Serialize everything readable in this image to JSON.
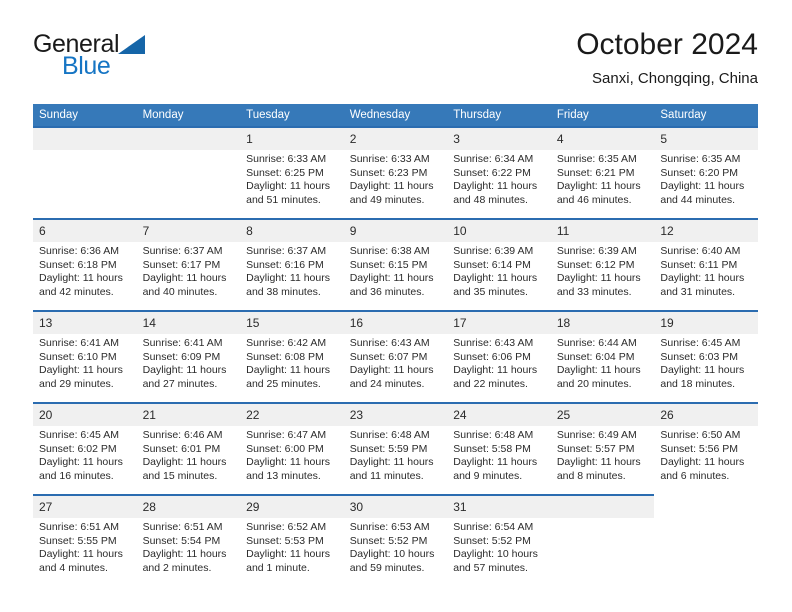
{
  "brand": {
    "name_part1": "General",
    "name_part2": "Blue",
    "triangle_color": "#1565a8",
    "blue_color": "#1675c4"
  },
  "header": {
    "title": "October 2024",
    "subtitle": "Sanxi, Chongqing, China"
  },
  "theme": {
    "header_bg": "#3679b9",
    "week_separator": "#2b6cb0",
    "daynum_bg": "#f0f0f0"
  },
  "weekdays": [
    "Sunday",
    "Monday",
    "Tuesday",
    "Wednesday",
    "Thursday",
    "Friday",
    "Saturday"
  ],
  "weeks": [
    [
      {
        "day": "",
        "sunrise": "",
        "sunset": "",
        "daylight1": "",
        "daylight2": "",
        "state": "empty"
      },
      {
        "day": "",
        "sunrise": "",
        "sunset": "",
        "daylight1": "",
        "daylight2": "",
        "state": "empty"
      },
      {
        "day": "1",
        "sunrise": "Sunrise: 6:33 AM",
        "sunset": "Sunset: 6:25 PM",
        "daylight1": "Daylight: 11 hours",
        "daylight2": "and 51 minutes.",
        "state": "filled"
      },
      {
        "day": "2",
        "sunrise": "Sunrise: 6:33 AM",
        "sunset": "Sunset: 6:23 PM",
        "daylight1": "Daylight: 11 hours",
        "daylight2": "and 49 minutes.",
        "state": "filled"
      },
      {
        "day": "3",
        "sunrise": "Sunrise: 6:34 AM",
        "sunset": "Sunset: 6:22 PM",
        "daylight1": "Daylight: 11 hours",
        "daylight2": "and 48 minutes.",
        "state": "filled"
      },
      {
        "day": "4",
        "sunrise": "Sunrise: 6:35 AM",
        "sunset": "Sunset: 6:21 PM",
        "daylight1": "Daylight: 11 hours",
        "daylight2": "and 46 minutes.",
        "state": "filled"
      },
      {
        "day": "5",
        "sunrise": "Sunrise: 6:35 AM",
        "sunset": "Sunset: 6:20 PM",
        "daylight1": "Daylight: 11 hours",
        "daylight2": "and 44 minutes.",
        "state": "filled"
      }
    ],
    [
      {
        "day": "6",
        "sunrise": "Sunrise: 6:36 AM",
        "sunset": "Sunset: 6:18 PM",
        "daylight1": "Daylight: 11 hours",
        "daylight2": "and 42 minutes.",
        "state": "filled"
      },
      {
        "day": "7",
        "sunrise": "Sunrise: 6:37 AM",
        "sunset": "Sunset: 6:17 PM",
        "daylight1": "Daylight: 11 hours",
        "daylight2": "and 40 minutes.",
        "state": "filled"
      },
      {
        "day": "8",
        "sunrise": "Sunrise: 6:37 AM",
        "sunset": "Sunset: 6:16 PM",
        "daylight1": "Daylight: 11 hours",
        "daylight2": "and 38 minutes.",
        "state": "filled"
      },
      {
        "day": "9",
        "sunrise": "Sunrise: 6:38 AM",
        "sunset": "Sunset: 6:15 PM",
        "daylight1": "Daylight: 11 hours",
        "daylight2": "and 36 minutes.",
        "state": "filled"
      },
      {
        "day": "10",
        "sunrise": "Sunrise: 6:39 AM",
        "sunset": "Sunset: 6:14 PM",
        "daylight1": "Daylight: 11 hours",
        "daylight2": "and 35 minutes.",
        "state": "filled"
      },
      {
        "day": "11",
        "sunrise": "Sunrise: 6:39 AM",
        "sunset": "Sunset: 6:12 PM",
        "daylight1": "Daylight: 11 hours",
        "daylight2": "and 33 minutes.",
        "state": "filled"
      },
      {
        "day": "12",
        "sunrise": "Sunrise: 6:40 AM",
        "sunset": "Sunset: 6:11 PM",
        "daylight1": "Daylight: 11 hours",
        "daylight2": "and 31 minutes.",
        "state": "filled"
      }
    ],
    [
      {
        "day": "13",
        "sunrise": "Sunrise: 6:41 AM",
        "sunset": "Sunset: 6:10 PM",
        "daylight1": "Daylight: 11 hours",
        "daylight2": "and 29 minutes.",
        "state": "filled"
      },
      {
        "day": "14",
        "sunrise": "Sunrise: 6:41 AM",
        "sunset": "Sunset: 6:09 PM",
        "daylight1": "Daylight: 11 hours",
        "daylight2": "and 27 minutes.",
        "state": "filled"
      },
      {
        "day": "15",
        "sunrise": "Sunrise: 6:42 AM",
        "sunset": "Sunset: 6:08 PM",
        "daylight1": "Daylight: 11 hours",
        "daylight2": "and 25 minutes.",
        "state": "filled"
      },
      {
        "day": "16",
        "sunrise": "Sunrise: 6:43 AM",
        "sunset": "Sunset: 6:07 PM",
        "daylight1": "Daylight: 11 hours",
        "daylight2": "and 24 minutes.",
        "state": "filled"
      },
      {
        "day": "17",
        "sunrise": "Sunrise: 6:43 AM",
        "sunset": "Sunset: 6:06 PM",
        "daylight1": "Daylight: 11 hours",
        "daylight2": "and 22 minutes.",
        "state": "filled"
      },
      {
        "day": "18",
        "sunrise": "Sunrise: 6:44 AM",
        "sunset": "Sunset: 6:04 PM",
        "daylight1": "Daylight: 11 hours",
        "daylight2": "and 20 minutes.",
        "state": "filled"
      },
      {
        "day": "19",
        "sunrise": "Sunrise: 6:45 AM",
        "sunset": "Sunset: 6:03 PM",
        "daylight1": "Daylight: 11 hours",
        "daylight2": "and 18 minutes.",
        "state": "filled"
      }
    ],
    [
      {
        "day": "20",
        "sunrise": "Sunrise: 6:45 AM",
        "sunset": "Sunset: 6:02 PM",
        "daylight1": "Daylight: 11 hours",
        "daylight2": "and 16 minutes.",
        "state": "filled"
      },
      {
        "day": "21",
        "sunrise": "Sunrise: 6:46 AM",
        "sunset": "Sunset: 6:01 PM",
        "daylight1": "Daylight: 11 hours",
        "daylight2": "and 15 minutes.",
        "state": "filled"
      },
      {
        "day": "22",
        "sunrise": "Sunrise: 6:47 AM",
        "sunset": "Sunset: 6:00 PM",
        "daylight1": "Daylight: 11 hours",
        "daylight2": "and 13 minutes.",
        "state": "filled"
      },
      {
        "day": "23",
        "sunrise": "Sunrise: 6:48 AM",
        "sunset": "Sunset: 5:59 PM",
        "daylight1": "Daylight: 11 hours",
        "daylight2": "and 11 minutes.",
        "state": "filled"
      },
      {
        "day": "24",
        "sunrise": "Sunrise: 6:48 AM",
        "sunset": "Sunset: 5:58 PM",
        "daylight1": "Daylight: 11 hours",
        "daylight2": "and 9 minutes.",
        "state": "filled"
      },
      {
        "day": "25",
        "sunrise": "Sunrise: 6:49 AM",
        "sunset": "Sunset: 5:57 PM",
        "daylight1": "Daylight: 11 hours",
        "daylight2": "and 8 minutes.",
        "state": "filled"
      },
      {
        "day": "26",
        "sunrise": "Sunrise: 6:50 AM",
        "sunset": "Sunset: 5:56 PM",
        "daylight1": "Daylight: 11 hours",
        "daylight2": "and 6 minutes.",
        "state": "filled"
      }
    ],
    [
      {
        "day": "27",
        "sunrise": "Sunrise: 6:51 AM",
        "sunset": "Sunset: 5:55 PM",
        "daylight1": "Daylight: 11 hours",
        "daylight2": "and 4 minutes.",
        "state": "filled"
      },
      {
        "day": "28",
        "sunrise": "Sunrise: 6:51 AM",
        "sunset": "Sunset: 5:54 PM",
        "daylight1": "Daylight: 11 hours",
        "daylight2": "and 2 minutes.",
        "state": "filled"
      },
      {
        "day": "29",
        "sunrise": "Sunrise: 6:52 AM",
        "sunset": "Sunset: 5:53 PM",
        "daylight1": "Daylight: 11 hours",
        "daylight2": "and 1 minute.",
        "state": "filled"
      },
      {
        "day": "30",
        "sunrise": "Sunrise: 6:53 AM",
        "sunset": "Sunset: 5:52 PM",
        "daylight1": "Daylight: 10 hours",
        "daylight2": "and 59 minutes.",
        "state": "filled"
      },
      {
        "day": "31",
        "sunrise": "Sunrise: 6:54 AM",
        "sunset": "Sunset: 5:52 PM",
        "daylight1": "Daylight: 10 hours",
        "daylight2": "and 57 minutes.",
        "state": "filled"
      },
      {
        "day": "",
        "sunrise": "",
        "sunset": "",
        "daylight1": "",
        "daylight2": "",
        "state": "empty"
      },
      {
        "day": "",
        "sunrise": "",
        "sunset": "",
        "daylight1": "",
        "daylight2": "",
        "state": "blank"
      }
    ]
  ]
}
